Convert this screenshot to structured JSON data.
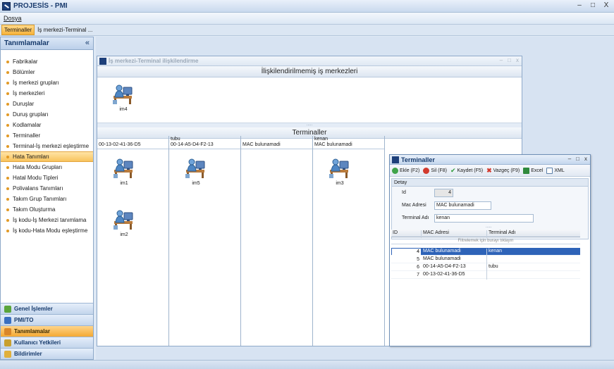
{
  "app": {
    "title": "PROJESİS - PMI",
    "controls": {
      "minimize": "–",
      "maximize": "□",
      "close": "X"
    }
  },
  "menu": {
    "file": "Dosya"
  },
  "tabs": [
    "Terminaller",
    "İş merkezi-Terminal ..."
  ],
  "nav": {
    "title": "Tanımlamalar",
    "collapse": "«",
    "items": [
      "Fabrikalar",
      "Bölümler",
      "İş merkezi grupları",
      "İş merkezleri",
      "Duruşlar",
      "Duruş grupları",
      "Kodlamalar",
      "Terminaller",
      "Terminal-İş merkezi eşleştirme",
      "Hata Tanımları",
      "Hata Modu Grupları",
      "Hatal Modu Tipleri",
      "Polivalans Tanımları",
      "Takım Grup Tanımları",
      "Takım Oluşturma",
      "İş kodu-İş Merkezi tanımlama",
      "İş kodu-Hata Modu eşleştirme"
    ],
    "selected_index": 9,
    "groups": [
      "Genel İşlemler",
      "PMI/TO",
      "Tanımlamalar",
      "Kullanıcı Yetkileri",
      "Bildirimler"
    ],
    "active_group": 2
  },
  "inner": {
    "title": "İş merkezi-Terminal ilişkilendirme",
    "controls": {
      "minimize": "–",
      "maximize": "□",
      "close": "x"
    },
    "unassigned_header": "İlişkilendirilmemiş iş merkezleri",
    "unassigned": [
      {
        "label": "im4"
      }
    ],
    "splitter": ".....",
    "terminals_header": "Terminaller",
    "columns": [
      {
        "line1": "",
        "line2": "00-13-02-41-36-D5",
        "items": [
          "im1",
          "im2"
        ]
      },
      {
        "line1": "tubu",
        "line2": "00-14-A5-D4-F2-13",
        "items": [
          "im5"
        ]
      },
      {
        "line1": "",
        "line2": "MAC bulunamadi",
        "items": []
      },
      {
        "line1": "kenan",
        "line2": "MAC bulunamadi",
        "items": [
          "im3"
        ]
      }
    ]
  },
  "terminal_window": {
    "title": "Terminaller",
    "controls": {
      "minimize": "–",
      "maximize": "□",
      "close": "x"
    },
    "toolbar": {
      "add": "Ekle (F2)",
      "delete": "Sil (F8)",
      "save": "Kaydet (F5)",
      "cancel": "Vazgeç (F9)",
      "excel": "Excel",
      "xml": "XML"
    },
    "detail": {
      "title": "Detay",
      "id_label": "Id",
      "id_value": "4",
      "mac_label": "Mac Adresi",
      "mac_value": "MAC bulunamadi",
      "name_label": "Terminal Adı",
      "name_value": "kenan"
    },
    "grid": {
      "splitter": ".....",
      "headers": {
        "id": "ID",
        "mac": "MAC Adresi",
        "name": "Terminal Adı"
      },
      "filter": "Filtrelemek için burayı tıklayın",
      "rows": [
        {
          "id": "4",
          "mac": "MAC bulunamadi",
          "name": "kenan"
        },
        {
          "id": "5",
          "mac": "MAC bulunamadi",
          "name": ""
        },
        {
          "id": "6",
          "mac": "00-14-A5-D4-F2-13",
          "name": "tubu"
        },
        {
          "id": "7",
          "mac": "00-13-02-41-36-D5",
          "name": ""
        }
      ],
      "selected_index": 0
    }
  },
  "colors": {
    "accent": "#f7b23a",
    "selection": "#2e63b8",
    "header_blue": "#15396b"
  }
}
